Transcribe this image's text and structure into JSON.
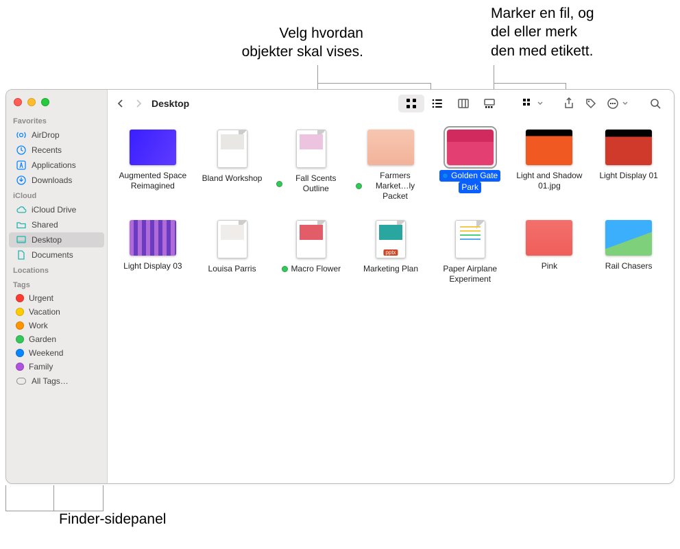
{
  "callouts": {
    "view": "Velg hvordan\nobjekter skal vises.",
    "share": "Marker en fil, og\ndel eller merk\nden med etikett.",
    "sidebar": "Finder-sidepanel"
  },
  "window": {
    "location": "Desktop"
  },
  "sidebar": {
    "sections": {
      "favorites": {
        "title": "Favorites",
        "items": [
          "AirDrop",
          "Recents",
          "Applications",
          "Downloads"
        ]
      },
      "icloud": {
        "title": "iCloud",
        "items": [
          "iCloud Drive",
          "Shared",
          "Desktop",
          "Documents"
        ],
        "selected": "Desktop"
      },
      "locations": {
        "title": "Locations"
      },
      "tags": {
        "title": "Tags",
        "items": [
          {
            "label": "Urgent",
            "color": "#ff3b30"
          },
          {
            "label": "Vacation",
            "color": "#ffcc00"
          },
          {
            "label": "Work",
            "color": "#ff9500"
          },
          {
            "label": "Garden",
            "color": "#34c759"
          },
          {
            "label": "Weekend",
            "color": "#0a84ff"
          },
          {
            "label": "Family",
            "color": "#af52de"
          }
        ],
        "all": "All Tags…"
      }
    }
  },
  "files": [
    {
      "name": "Augmented Space Reimagined",
      "tag": null,
      "kind": "image",
      "thumb": "g1",
      "selected": false
    },
    {
      "name": "Bland Workshop",
      "tag": null,
      "kind": "doc",
      "thumb": "g2",
      "selected": false
    },
    {
      "name": "Fall Scents Outline",
      "tag": "green",
      "kind": "doc",
      "thumb": "g3",
      "selected": false
    },
    {
      "name": "Farmers Market…ly Packet",
      "tag": "green",
      "kind": "image",
      "thumb": "g4",
      "selected": false
    },
    {
      "name": "Golden Gate Park",
      "tag": "blue",
      "kind": "image",
      "thumb": "g5",
      "selected": true
    },
    {
      "name": "Light and Shadow 01.jpg",
      "tag": null,
      "kind": "image",
      "thumb": "g6",
      "selected": false
    },
    {
      "name": "Light Display 01",
      "tag": null,
      "kind": "image",
      "thumb": "g7",
      "selected": false
    },
    {
      "name": "Light Display 03",
      "tag": null,
      "kind": "image",
      "thumb": "g8",
      "selected": false
    },
    {
      "name": "Louisa Parris",
      "tag": null,
      "kind": "doc",
      "thumb": "g9",
      "selected": false
    },
    {
      "name": "Macro Flower",
      "tag": "green",
      "kind": "doc",
      "thumb": "g10",
      "selected": false
    },
    {
      "name": "Marketing Plan",
      "tag": null,
      "kind": "doc",
      "thumb": "g11",
      "selected": false,
      "badge": "pptx"
    },
    {
      "name": "Paper Airplane Experiment",
      "tag": null,
      "kind": "doc",
      "thumb": "g12",
      "selected": false,
      "lines": true
    },
    {
      "name": "Pink",
      "tag": null,
      "kind": "image",
      "thumb": "g13",
      "selected": false
    },
    {
      "name": "Rail Chasers",
      "tag": null,
      "kind": "image",
      "thumb": "g14",
      "selected": false
    }
  ]
}
